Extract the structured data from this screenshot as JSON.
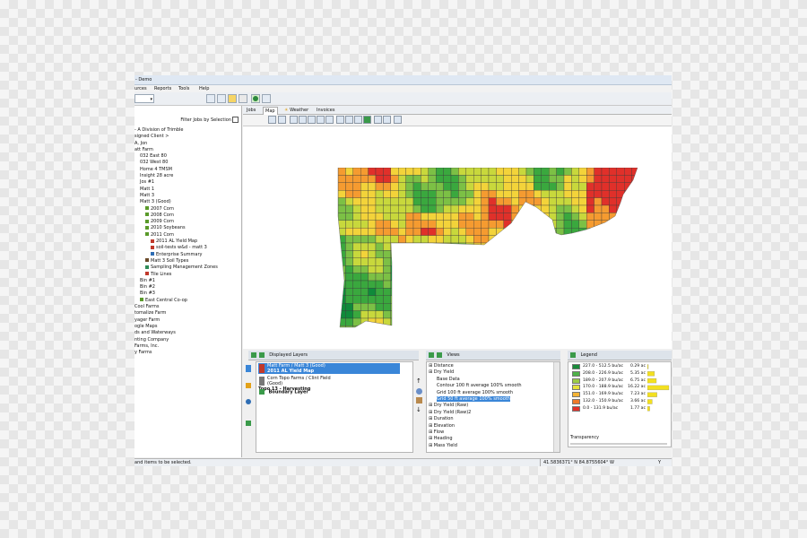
{
  "window": {
    "title": "- Demo"
  },
  "menu": [
    "ources",
    "Reports",
    "Tools",
    "Help"
  ],
  "left_panel": {
    "filter_label": "Filter Jobs by Selection",
    "tree": [
      {
        "label": "- A Division of Trimble",
        "indent": 0
      },
      {
        "label": "signed Client >",
        "indent": 0
      },
      {
        "label": "A, Jon",
        "indent": 0
      },
      {
        "label": "att Farm",
        "indent": 0
      },
      {
        "label": "032 East 80",
        "indent": 1
      },
      {
        "label": "032 West 80",
        "indent": 1
      },
      {
        "label": "Home 4 TMSM",
        "indent": 1
      },
      {
        "label": "Insight 28 acre",
        "indent": 1
      },
      {
        "label": "Jos #1",
        "indent": 1
      },
      {
        "label": "Matt 1",
        "indent": 1
      },
      {
        "label": "Matt 3",
        "indent": 1
      },
      {
        "label": "Matt 3 (Good)",
        "indent": 1
      },
      {
        "label": "2007 Corn",
        "indent": 2,
        "icon": "#5a9a2a"
      },
      {
        "label": "2008 Corn",
        "indent": 2,
        "icon": "#5a9a2a"
      },
      {
        "label": "2009 Corn",
        "indent": 2,
        "icon": "#5a9a2a"
      },
      {
        "label": "2010 Soybeans",
        "indent": 2,
        "icon": "#5a9a2a"
      },
      {
        "label": "2011 Corn",
        "indent": 2,
        "icon": "#5a9a2a"
      },
      {
        "label": "2011 AL Yield Map",
        "indent": 3,
        "icon": "#c0392b"
      },
      {
        "label": "soil-tests w&d - matt 3",
        "indent": 3,
        "icon": "#c0392b"
      },
      {
        "label": "Enterprise Summary",
        "indent": 3,
        "icon": "#2e6db4"
      },
      {
        "label": "Matt 3 Soil Types",
        "indent": 2,
        "icon": "#6b4a2a"
      },
      {
        "label": "Sampling Management Zones",
        "indent": 2,
        "icon": "#2e8b57"
      },
      {
        "label": "Tile Lines",
        "indent": 2,
        "icon": "#c0392b"
      },
      {
        "label": "Bin #1",
        "indent": 1
      },
      {
        "label": "Bin #2",
        "indent": 1
      },
      {
        "label": "Bin #3",
        "indent": 1
      },
      {
        "label": "East Central Co-op",
        "indent": 1,
        "icon": "#5a9a2a"
      },
      {
        "label": "Cool Farms",
        "indent": 0
      },
      {
        "label": "tomalize Farm",
        "indent": 0
      },
      {
        "label": "yager Farm",
        "indent": 0
      },
      {
        "label": "ogle Maps",
        "indent": 0
      },
      {
        "label": "ds and Waterways",
        "indent": 0
      },
      {
        "label": "nting Company",
        "indent": 0
      },
      {
        "label": "Farms, Inc.",
        "indent": 0
      },
      {
        "label": "y Farms",
        "indent": 0
      }
    ]
  },
  "tabs": [
    {
      "label": "Jobs",
      "active": false
    },
    {
      "label": "Map",
      "active": true
    },
    {
      "label": "Weather",
      "active": false
    },
    {
      "label": "Invoices",
      "active": false
    }
  ],
  "displayed_layers": {
    "title": "Displayed Layers",
    "items": [
      {
        "line1": "Matt Farm / Matt 3 (Good)",
        "line2": "2011 AL Yield Map",
        "selected": true
      },
      {
        "line1": "Corn Topo Farms / Clint Field (Good)",
        "line2": "Topo 13 - Harvesting",
        "selected": false
      },
      {
        "line1": "Boundary Layer",
        "line2": "",
        "selected": false
      }
    ]
  },
  "views": {
    "title": "Views",
    "items": [
      {
        "label": "Distance",
        "indent": 0,
        "selected": false
      },
      {
        "label": "Dry Yield",
        "indent": 0,
        "selected": false
      },
      {
        "label": "Base Data",
        "indent": 1,
        "selected": false
      },
      {
        "label": "Contour 100 ft average 100% smooth",
        "indent": 1,
        "selected": false
      },
      {
        "label": "Grid 100 ft average 100% smooth",
        "indent": 1,
        "selected": false
      },
      {
        "label": "Grid 50 ft average 100% smooth",
        "indent": 1,
        "selected": true
      },
      {
        "label": "Dry Yield (Raw)",
        "indent": 0,
        "selected": false
      },
      {
        "label": "Dry Yield (Raw)2",
        "indent": 0,
        "selected": false
      },
      {
        "label": "Duration",
        "indent": 0,
        "selected": false
      },
      {
        "label": "Elevation",
        "indent": 0,
        "selected": false
      },
      {
        "label": "Flow",
        "indent": 0,
        "selected": false
      },
      {
        "label": "Heading",
        "indent": 0,
        "selected": false
      },
      {
        "label": "Mass Yield",
        "indent": 0,
        "selected": false
      }
    ]
  },
  "legend": {
    "title": "Legend",
    "transparency_label": "Transparency",
    "items": [
      {
        "range": "227.0 - 512.5 bu/ac",
        "area": "0.29 ac",
        "color": "#1a8a3a"
      },
      {
        "range": "208.0 - 226.9 bu/ac",
        "area": "5.35 ac",
        "color": "#4eb048"
      },
      {
        "range": "189.0 - 207.9 bu/ac",
        "area": "6.75 ac",
        "color": "#9ccc48"
      },
      {
        "range": "170.0 - 188.9 bu/ac",
        "area": "16.22 ac",
        "color": "#e6e23a"
      },
      {
        "range": "151.0 - 169.9 bu/ac",
        "area": "7.23 ac",
        "color": "#f5b335"
      },
      {
        "range": "132.0 - 150.9 bu/ac",
        "area": "3.66 ac",
        "color": "#ef7a2a"
      },
      {
        "range": "0.0 - 131.9 bu/ac",
        "area": "1.77 ac",
        "color": "#e2312a"
      }
    ],
    "histogram": [
      0.29,
      5.35,
      6.75,
      16.22,
      7.23,
      3.66,
      1.77
    ]
  },
  "status": {
    "message": "and items to be selected.",
    "coords": "41.5836371° N    84.8755604° W",
    "extra": "Y"
  },
  "colors": {
    "yield_ramp": [
      "#0f8a3a",
      "#3aa83e",
      "#7cc045",
      "#c8d83c",
      "#f3d33a",
      "#f59b30",
      "#e0302a"
    ],
    "selection": "#3a86d8"
  }
}
